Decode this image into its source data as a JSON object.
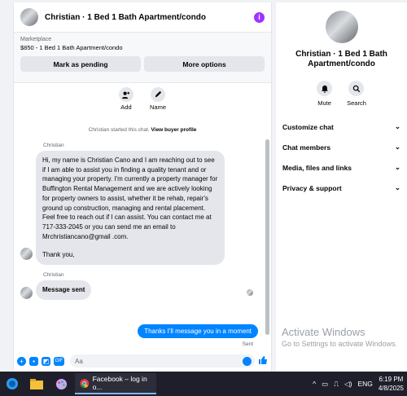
{
  "header": {
    "title": "Christian · 1 Bed 1 Bath Apartment/condo",
    "info_icon": "info-icon"
  },
  "marketplace": {
    "label": "Marketplace",
    "item": "$850 - 1 Bed 1 Bath Apartment/condo",
    "pending_button": "Mark as pending",
    "more_button": "More options"
  },
  "quick_actions": [
    {
      "label": "Add",
      "icon": "add-person-icon"
    },
    {
      "label": "Name",
      "icon": "pencil-icon"
    }
  ],
  "system_note": {
    "text": "Christian started this chat.",
    "link": "View buyer profile"
  },
  "messages": [
    {
      "sender": "Christian",
      "body": "Hi, my name is Christian Cano and I am reaching out to see if I am able to assist you in finding a quality tenant and or managing your property. I'm currently a property manager for Buffington Rental Management and we are actively looking for property owners to assist, whether it be rehab, repair's ground up construction, managing and rental placement. Feel free to reach out if I can assist. You can contact me at 717-333-2045 or you can send me an email to Mrchristiancano@gmail .com.",
      "closing": "Thank you,"
    },
    {
      "sender": "Christian",
      "body": "Message sent"
    }
  ],
  "outgoing": {
    "text": "Thanks I'll message you in a moment",
    "status": "Sent"
  },
  "composer": {
    "placeholder": "Aa"
  },
  "info_panel": {
    "name": "Christian · 1 Bed 1 Bath Apartment/condo",
    "actions": [
      {
        "label": "Mute",
        "icon": "bell-icon"
      },
      {
        "label": "Search",
        "icon": "search-icon"
      }
    ],
    "sections": [
      "Customize chat",
      "Chat members",
      "Media, files and links",
      "Privacy & support"
    ]
  },
  "watermark": {
    "title": "Activate Windows",
    "subtitle": "Go to Settings to activate Windows."
  },
  "taskbar": {
    "app_title": "Facebook – log in o...",
    "language": "ENG",
    "time": "6:19 PM",
    "date": "4/8/2025"
  },
  "colors": {
    "accent": "#0084ff",
    "bubble_in": "#e4e6eb",
    "info_dot": "#a033ff"
  }
}
